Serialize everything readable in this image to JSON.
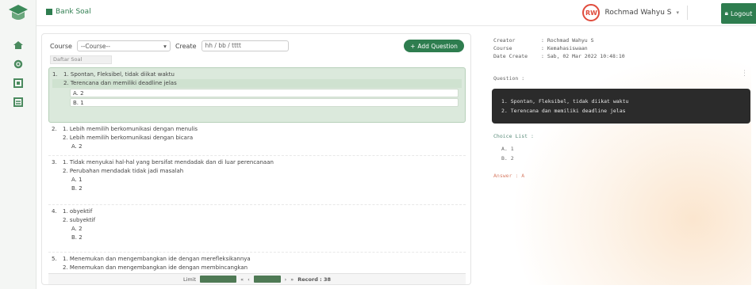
{
  "topbar": {
    "brand_label": "Bank Soal",
    "user_name": "Rochmad Wahyu S",
    "avatar_initials": "RW",
    "logout_label": "Logout"
  },
  "filters": {
    "course_label": "Course",
    "course_value": "--Course--",
    "create_label": "Create",
    "create_placeholder": "hh / bb / tttt",
    "add_button": "Add Question",
    "list_caption": "Daftar Soal"
  },
  "questions": [
    {
      "num": "1.",
      "lines": [
        "1. Spontan, Fleksibel, tidak diikat waktu",
        "2. Terencana dan memiliki deadline jelas"
      ],
      "choices": [
        "A. 2",
        "B. 1"
      ],
      "active": true
    },
    {
      "num": "2.",
      "lines": [
        "1. Lebih memilih berkomunikasi dengan menulis",
        "2. Lebih memilih berkomunikasi dengan bicara"
      ],
      "choices": [
        "A. 2"
      ],
      "active": false
    },
    {
      "num": "3.",
      "lines": [
        "1. Tidak menyukai hal-hal yang bersifat mendadak dan di luar perencanaan",
        "2. Perubahan mendadak tidak jadi masalah"
      ],
      "choices": [
        "A. 1",
        "B. 2"
      ],
      "active": false
    },
    {
      "num": "4.",
      "lines": [
        "1. obyektif",
        "2. subyektif"
      ],
      "choices": [
        "A. 2",
        "B. 2"
      ],
      "active": false
    },
    {
      "num": "5.",
      "lines": [
        "1. Menemukan dan mengembangkan ide dengan merefleksikannya",
        "2. Menemukan dan mengembangkan ide dengan membincangkan"
      ],
      "choices": [],
      "active": false
    }
  ],
  "pager": {
    "limit_label": "Limit",
    "records_label": "Record : 38"
  },
  "detail": {
    "creator_key": "Creator",
    "creator_val": ": Rochmad Wahyu S",
    "course_key": "Course",
    "course_val": ": Kemahasiswaan",
    "date_key": "Date Create",
    "date_val": ": Sab, 02 Mar 2022 10:48:10",
    "question_label": "Question :",
    "code_lines": [
      "1. Spontan, Fleksibel, tidak diikat waktu",
      "2. Terencana dan memiliki deadline jelas"
    ],
    "choice_label": "Choice List :",
    "choice_items": [
      "A. 1",
      "B. 2"
    ],
    "answer_label": "Answer : A"
  },
  "colors": {
    "brand": "#2e7d4f",
    "active_row": "#dbe9dc",
    "code_bg": "#2b2b2b",
    "avatar_ring": "#e04b3c"
  }
}
